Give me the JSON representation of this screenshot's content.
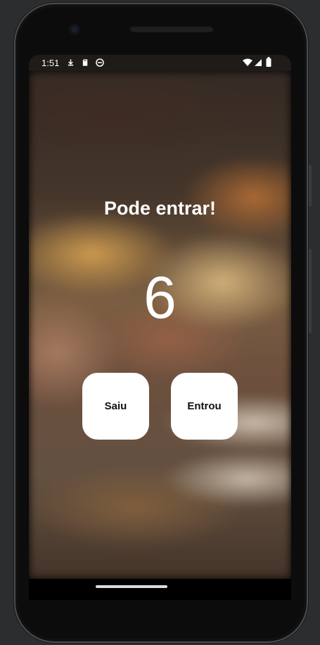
{
  "status_bar": {
    "time": "1:51",
    "left_icons": [
      "download-icon",
      "sd-card-icon",
      "app-notification-icon"
    ],
    "right_icons": [
      "wifi-icon",
      "signal-icon",
      "battery-icon"
    ]
  },
  "screen": {
    "headline": "Pode entrar!",
    "counter": "6",
    "buttons": {
      "left_label": "Saiu",
      "right_label": "Entrou"
    }
  },
  "colors": {
    "button_bg": "#ffffff",
    "text": "#ffffff",
    "button_text": "#111111"
  }
}
